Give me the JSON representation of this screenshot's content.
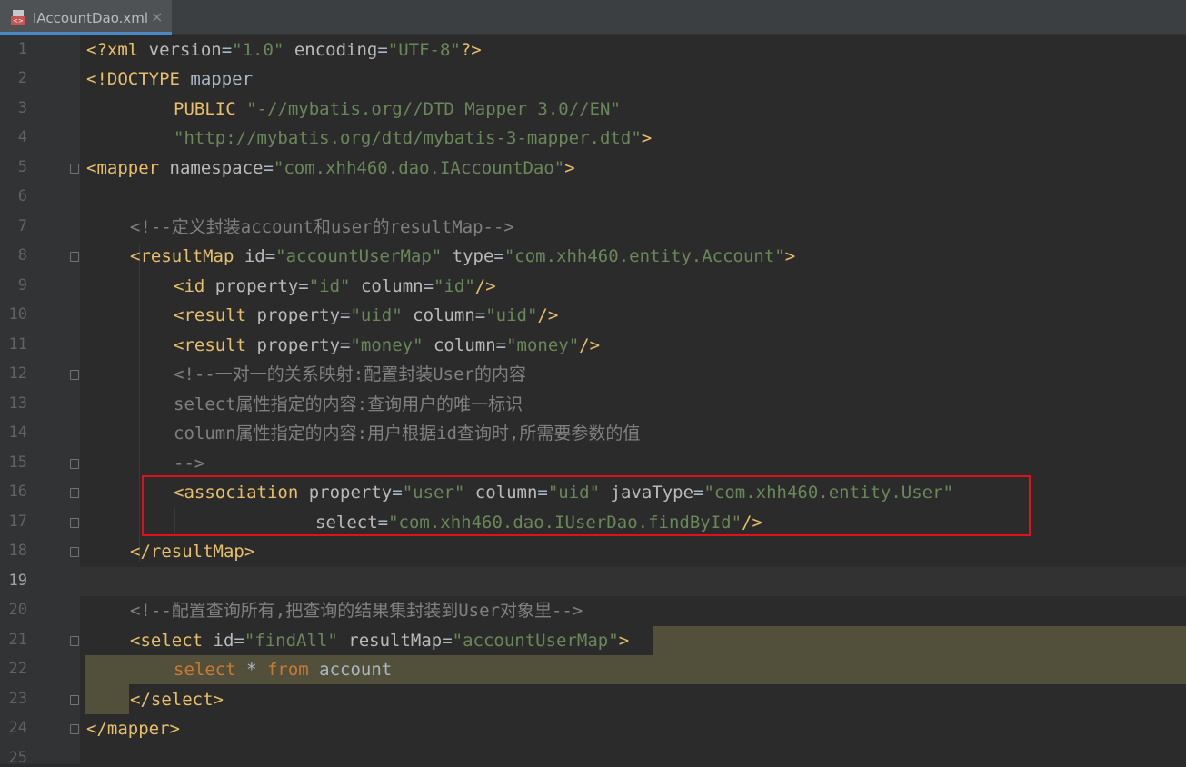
{
  "tab": {
    "icon": "xml-file-icon",
    "label": "IAccountDao.xml",
    "close": "×"
  },
  "colors": {
    "tag": "#e8bf6a",
    "attribute": "#bababa",
    "string": "#6a8759",
    "comment": "#808080",
    "keyword": "#cc7832",
    "highlight": "#52503a",
    "annotation_box": "#e0111a"
  },
  "lines": {
    "l1": {
      "n": "1"
    },
    "l2": {
      "n": "2"
    },
    "l3": {
      "n": "3"
    },
    "l4": {
      "n": "4"
    },
    "l5": {
      "n": "5"
    },
    "l6": {
      "n": "6"
    },
    "l7": {
      "n": "7"
    },
    "l8": {
      "n": "8"
    },
    "l9": {
      "n": "9"
    },
    "l10": {
      "n": "10"
    },
    "l11": {
      "n": "11"
    },
    "l12": {
      "n": "12"
    },
    "l13": {
      "n": "13"
    },
    "l14": {
      "n": "14"
    },
    "l15": {
      "n": "15"
    },
    "l16": {
      "n": "16"
    },
    "l17": {
      "n": "17"
    },
    "l18": {
      "n": "18"
    },
    "l19": {
      "n": "19"
    },
    "l20": {
      "n": "20"
    },
    "l21": {
      "n": "21"
    },
    "l22": {
      "n": "22"
    },
    "l23": {
      "n": "23"
    },
    "l24": {
      "n": "24"
    },
    "l25": {
      "n": "25"
    }
  },
  "code": {
    "xml_decl_open": "<?xml ",
    "version_attr": "version",
    "eq": "=",
    "version_val": "\"1.0\"",
    "encoding_attr": " encoding",
    "encoding_val": "\"UTF-8\"",
    "xml_decl_close": "?>",
    "doctype_open": "<!DOCTYPE",
    "doctype_name": " mapper",
    "public_kw": "PUBLIC",
    "public_id": "\"-//mybatis.org//DTD Mapper 3.0//EN\"",
    "system_id": "\"http://mybatis.org/dtd/mybatis-3-mapper.dtd\"",
    "gt": ">",
    "mapper_open": "<mapper",
    "namespace_attr": " namespace",
    "namespace_val": "\"com.xhh460.dao.IAccountDao\"",
    "comment1": "<!--定义封装account和user的resultMap-->",
    "resultmap_open": "<resultMap",
    "id_attr": " id",
    "resultmap_id_val": "\"accountUserMap\"",
    "type_attr": " type",
    "type_val": "\"com.xhh460.entity.Account\"",
    "id_tag": "<id",
    "property_attr": " property",
    "id_prop_val": "\"id\"",
    "column_attr": " column",
    "id_col_val": "\"id\"",
    "selfclose": "/>",
    "result_tag": "<result",
    "uid_val": "\"uid\"",
    "money_val": "\"money\"",
    "comment2_l1": "<!--一对一的关系映射:配置封装User的内容",
    "comment2_l2": "select属性指定的内容:查询用户的唯一标识",
    "comment2_l3": "column属性指定的内容:用户根据id查询时,所需要参数的值",
    "comment2_l4": "-->",
    "association_tag": "<association",
    "user_val": "\"user\"",
    "javatype_attr": " javaType",
    "javatype_val": "\"com.xhh460.entity.User\"",
    "select_attr": "select",
    "select_val": "\"com.xhh460.dao.IUserDao.findById\"",
    "resultmap_close": "</resultMap>",
    "comment3": "<!--配置查询所有,把查询的结果集封装到User对象里-->",
    "select_open": "<select",
    "select_id_val": "\"findAll\"",
    "resultmap_attr": " resultMap",
    "select_rm_val": "\"accountUserMap\"",
    "sql_select": "select",
    "sql_star": " * ",
    "sql_from": "from",
    "sql_table": " account",
    "select_close": "</select>",
    "mapper_close": "</mapper>"
  }
}
